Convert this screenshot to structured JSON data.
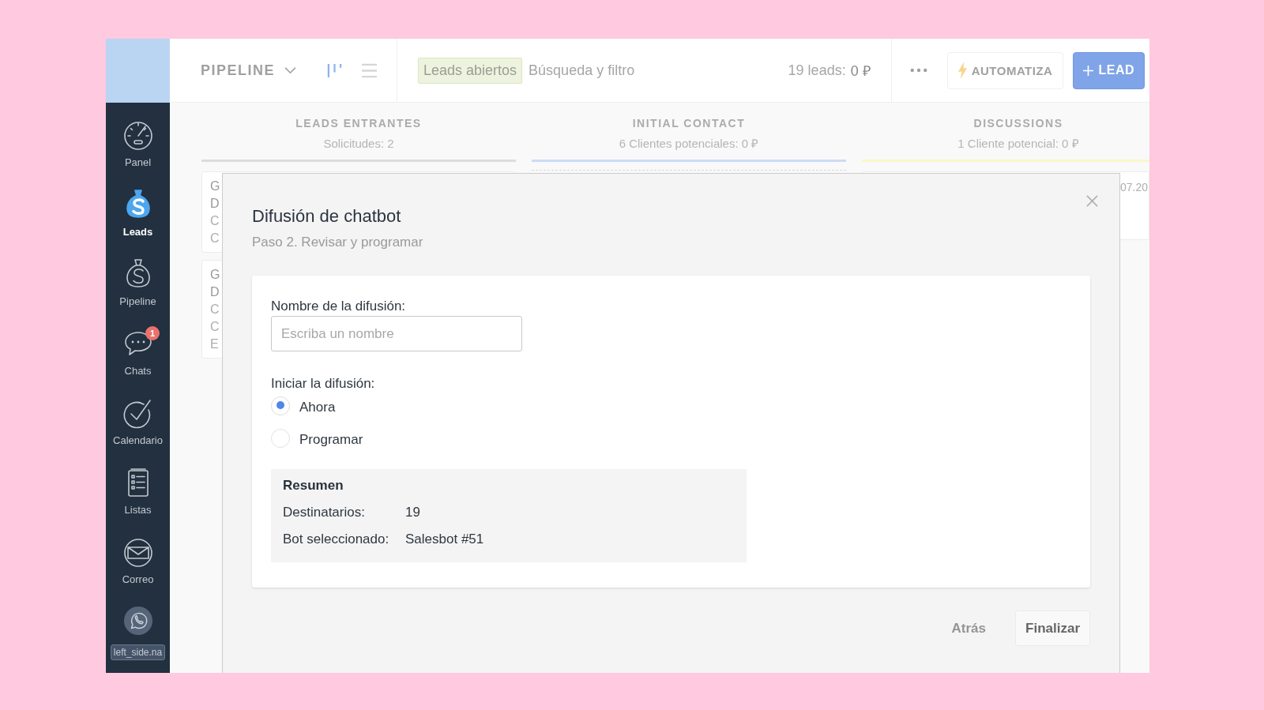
{
  "sidebar": {
    "items": [
      {
        "kind": "dashboard",
        "label": "Panel",
        "selected": false
      },
      {
        "kind": "leads",
        "label": "Leads",
        "selected": true
      },
      {
        "kind": "pipeline",
        "label": "Pipeline",
        "selected": false
      },
      {
        "kind": "chats",
        "label": "Chats",
        "selected": false,
        "badge": "1"
      },
      {
        "kind": "calendar",
        "label": "Calendario",
        "selected": false
      },
      {
        "kind": "lists",
        "label": "Listas",
        "selected": false
      },
      {
        "kind": "mail",
        "label": "Correo",
        "selected": false
      },
      {
        "kind": "whatsapp",
        "label": "left_side.na",
        "selected": false
      }
    ]
  },
  "toolbar": {
    "title": "PIPELINE",
    "view_toggles": [
      {
        "kind": "board",
        "selected": true
      },
      {
        "kind": "list",
        "selected": false
      }
    ],
    "filter_chip": "Leads abiertos",
    "search": {
      "placeholder": "Búsqueda y filtro"
    },
    "count_label": "19 leads:",
    "count_value": "0 ₽",
    "buttons": [
      {
        "kind": "automate",
        "label": "AUTOMATIZA"
      },
      {
        "kind": "add",
        "label": "LEAD"
      }
    ]
  },
  "columns": [
    {
      "title": "LEADS ENTRANTES",
      "subtitle": "Solicitudes: 2",
      "color": "#dcdcdc",
      "cards": [
        {
          "title_lines": [
            "G",
            "D"
          ],
          "detail_lines": [
            "C",
            "C"
          ]
        },
        {
          "title_lines": [
            "G",
            "D"
          ],
          "detail_lines": [
            "C",
            "C",
            "E"
          ]
        }
      ]
    },
    {
      "title": "INITIAL CONTACT",
      "subtitle": "6 Clientes potenciales: 0 ₽",
      "color": "#cddcf6"
    },
    {
      "title": "DISCUSSIONS",
      "subtitle": "1 Cliente potencial: 0 ₽",
      "color": "#fbf6c9",
      "cards": [
        {
          "date": "07.20"
        }
      ]
    }
  ],
  "dialog": {
    "title": "Difusión de chatbot",
    "subtitle": "Paso 2. Revisar y programar",
    "name_field": {
      "label": "Nombre de la difusión:",
      "placeholder": "Escriba un nombre"
    },
    "start": {
      "label": "Iniciar la difusión:",
      "options": [
        {
          "label": "Ahora",
          "selected": true
        },
        {
          "label": "Programar",
          "selected": false
        }
      ]
    },
    "summary": {
      "title": "Resumen",
      "rows": [
        {
          "label": "Destinatarios:",
          "value": "19"
        },
        {
          "label": "Bot seleccionado:",
          "value": "Salesbot #51"
        }
      ]
    },
    "buttons": [
      {
        "kind": "back",
        "label": "Atrás"
      },
      {
        "kind": "finish",
        "label": "Finalizar"
      }
    ]
  }
}
